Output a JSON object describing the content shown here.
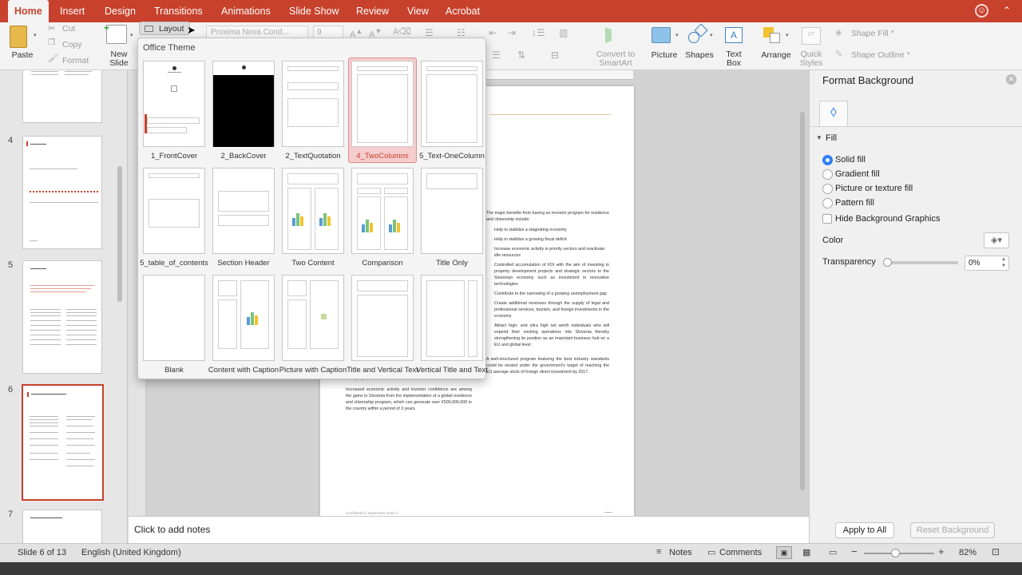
{
  "ribbon_tabs": [
    "Home",
    "Insert",
    "Design",
    "Transitions",
    "Animations",
    "Slide Show",
    "Review",
    "View",
    "Acrobat"
  ],
  "ribbon": {
    "paste": "Paste",
    "cut": "Cut",
    "copy": "Copy",
    "format": "Format",
    "new_slide": "New Slide",
    "layout": "Layout",
    "font": "Proxima Nova Cond...",
    "size": "9",
    "convert": "Convert to SmartArt",
    "picture": "Picture",
    "shapes": "Shapes",
    "text_box": "Text Box",
    "arrange": "Arrange",
    "quick_styles": "Quick Styles",
    "shape_fill": "Shape Fill",
    "shape_outline": "Shape Outline"
  },
  "gallery": {
    "title": "Office Theme",
    "selected": "4_TwoColumns",
    "layouts": [
      "1_FrontCover",
      "2_BackCover",
      "2_TextQuotation",
      "4_TwoColumns",
      "5_Text-OneColumn",
      "5_table_of_contents",
      "Section Header",
      "Two Content",
      "Comparison",
      "Title Only",
      "Blank",
      "Content with Caption",
      "Picture with Caption",
      "Title and Vertical Text",
      "Vertical Title and Text"
    ]
  },
  "thumbnails": {
    "numbers": [
      "4",
      "5",
      "6",
      "7"
    ],
    "selected": "6"
  },
  "slide": {
    "right_col": [
      "The major benefits from having an investor program for residence and citizenship include:",
      "Help to stabilize a stagnating economy",
      "Help to stabilize a growing fiscal deficit",
      "Increase economic activity in priority sectors and reactivate idle resources",
      "Controlled accumulation of FDI with the aim of investing in property development projects and strategic sectors to the Slovenian economy such as investment in innovative technologies",
      "Contribute to the narrowing of a growing unemployment gap",
      "Create additional revenues through the supply of legal and professional services, tourism, and foreign investments in the economy",
      "Attract high- and ultra high net worth individuals who will expend their existing operations into Slovenia thereby strengthening its position as an important business hub on a EU and global level",
      "A well-structured program featuring the best industry standards could be nested under the government's target of reaching the EU average stock of foreign direct investment by 2017."
    ],
    "left_col": [
      "unemployment.",
      "Increased economic activity and investor confidence are among the gains to Slovenia from the implementation of a global residence and citizenship program, which can generate over €500,000,000 in the country within a period of 3 years."
    ],
    "footer": "Confidential | September 2016 ©"
  },
  "notes": "Click to add notes",
  "format_pane": {
    "title": "Format Background",
    "section": "Fill",
    "options": [
      "Solid fill",
      "Gradient fill",
      "Picture or texture fill",
      "Pattern fill"
    ],
    "selected": "Solid fill",
    "hide_graphics": "Hide Background Graphics",
    "color_label": "Color",
    "transparency_label": "Transparency",
    "transparency_value": "0%",
    "transparency_level": 0,
    "apply_all": "Apply to All",
    "reset": "Reset Background"
  },
  "status": {
    "slide": "Slide 6 of 13",
    "language": "English (United Kingdom)",
    "notes": "Notes",
    "comments": "Comments",
    "zoom": "82%",
    "zoom_level": 0.5
  },
  "colors": {
    "accent": "#c8412c",
    "selection": "#2f7ef5"
  }
}
